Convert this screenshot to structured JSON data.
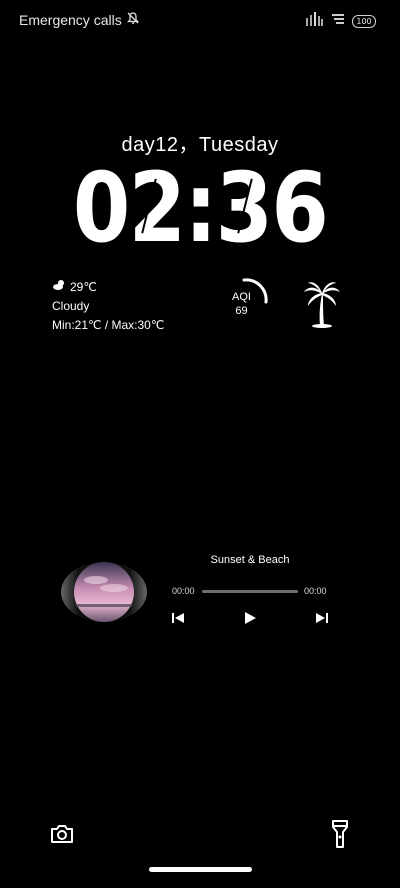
{
  "status_bar": {
    "carrier_text": "Emergency calls",
    "battery": "100",
    "icons": [
      "mute-icon",
      "signal-icon",
      "wifi-icon",
      "battery-icon"
    ]
  },
  "lockscreen": {
    "date_line": "day12，Tuesday",
    "time": "02:36"
  },
  "weather": {
    "temperature": "29℃",
    "condition": "Cloudy",
    "range": "Min:21℃  /  Max:30℃",
    "icon": "cloudy-icon"
  },
  "aqi": {
    "label": "AQI",
    "value": "69"
  },
  "music": {
    "title": "Sunset & Beach",
    "elapsed": "00:00",
    "duration": "00:00",
    "progress": 0
  },
  "bottom": {
    "left_icon": "camera-icon",
    "right_icon": "flashlight-icon"
  },
  "colors": {
    "background": "#000000",
    "text": "#ffffff",
    "progress_track": "#6f6f6f"
  }
}
